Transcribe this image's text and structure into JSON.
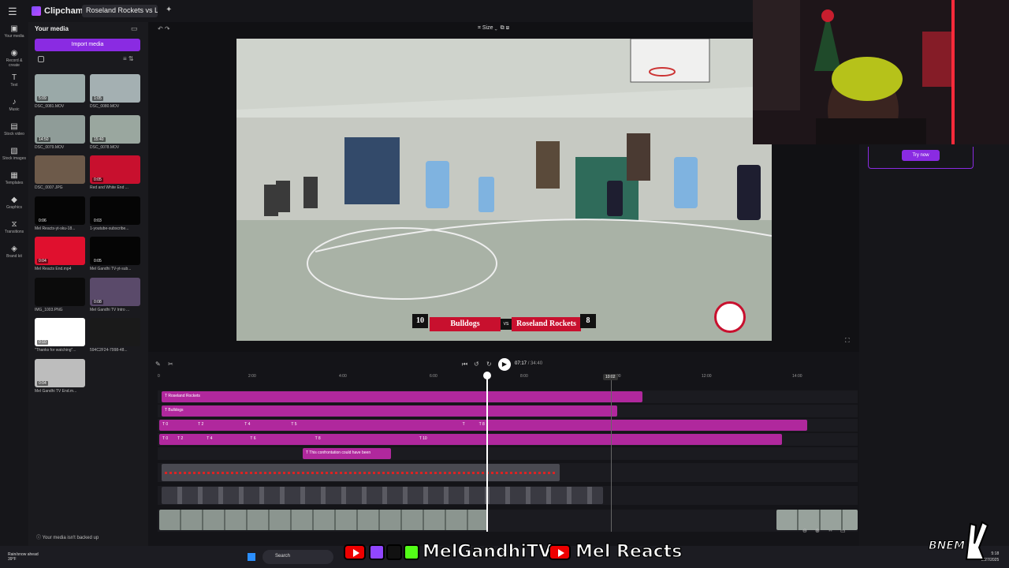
{
  "app": {
    "name": "Clipchamp",
    "project_title": "Roseland Rockets vs Lucky L"
  },
  "rail": [
    {
      "label": "Your media",
      "icon": "folder-icon"
    },
    {
      "label": "Record & create",
      "icon": "camera-icon"
    },
    {
      "label": "Text",
      "icon": "text-icon"
    },
    {
      "label": "Music",
      "icon": "music-icon"
    },
    {
      "label": "Stock video",
      "icon": "film-icon"
    },
    {
      "label": "Stock images",
      "icon": "image-icon"
    },
    {
      "label": "Templates",
      "icon": "template-icon"
    },
    {
      "label": "Graphics",
      "icon": "shapes-icon"
    },
    {
      "label": "Transitions",
      "icon": "transition-icon"
    },
    {
      "label": "Brand kit",
      "icon": "brand-icon"
    }
  ],
  "media": {
    "title": "Your media",
    "import_label": "Import media",
    "backup_notice": "Your media isn't backed up",
    "items": [
      {
        "name": "DSC_0081.MOV",
        "duration": "5:09",
        "color": "#9aa9a8"
      },
      {
        "name": "DSC_0080.MOV",
        "duration": "1:05",
        "color": "#a4b0b2"
      },
      {
        "name": "DSC_0079.MOV",
        "duration": "14:50",
        "color": "#8f9c98"
      },
      {
        "name": "DSC_0078.MOV",
        "duration": "15:40",
        "color": "#9aa79f"
      },
      {
        "name": "DSC_0007.JPG",
        "duration": "",
        "color": "#6d5a4a"
      },
      {
        "name": "Red and White End ...",
        "duration": "0:05",
        "color": "#c8102e"
      },
      {
        "name": "Mel Reacts-yt-sku-18...",
        "duration": "0:06",
        "color": "#050505"
      },
      {
        "name": "1-youtube-subscribe...",
        "duration": "0:03",
        "color": "#050505"
      },
      {
        "name": "Mel Reacts End.mp4",
        "duration": "0:04",
        "color": "#e0102e"
      },
      {
        "name": "Mel Gandhi TV-yt-sub...",
        "duration": "0:05",
        "color": "#050505"
      },
      {
        "name": "IMG_1003.PNG",
        "duration": "",
        "color": "#0b0b0b"
      },
      {
        "name": "Mel Gandhi TV Intro ...",
        "duration": "0:08",
        "color": "#5a4a6a"
      },
      {
        "name": "\"Thanks for watching\"...",
        "duration": "0:10",
        "color": "#ffffff"
      },
      {
        "name": "594C2F24-7998-48...",
        "duration": "",
        "color": "#1a1a1a"
      },
      {
        "name": "Mel Gandhi TV End.m...",
        "duration": "0:04",
        "color": "#bdbdbd"
      }
    ]
  },
  "preview": {
    "size_label": "Size",
    "scoreboard": {
      "left_score": "10",
      "left_team": "Bulldogs",
      "vs": "VS",
      "right_team": "Roseland Rockets",
      "right_score": "8"
    }
  },
  "right_panel": {
    "try_label": "Try now"
  },
  "timeline": {
    "current_time": "07:17",
    "total_time": "/ 34:40",
    "marker_time": "10:02",
    "ruler": [
      "0",
      "2:00",
      "4:00",
      "6:00",
      "8:00",
      "10:00",
      "12:00",
      "14:00"
    ],
    "tracks": {
      "t1": "Roseland Rockets",
      "t2": "Bulldogs",
      "t3": [
        "0",
        "2",
        "4",
        "5",
        "",
        "8"
      ],
      "t4": [
        "0",
        "2",
        "4",
        "6",
        "8",
        "10"
      ],
      "t5": "This confrontation could have been"
    }
  },
  "taskbar": {
    "weather_title": "Rain/snow ahead",
    "weather_temp": "39°F",
    "search_label": "Search",
    "time": "5:18",
    "date": "2/27/2025"
  },
  "overlay": {
    "channel1": "MelGandhiTV",
    "channel2": "Mel Reacts",
    "bnem": "BNEM"
  }
}
